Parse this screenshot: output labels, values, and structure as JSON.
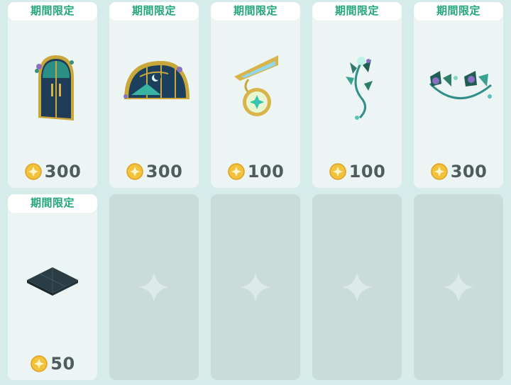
{
  "items": [
    {
      "badge": "期間限定",
      "price": "300",
      "icon": "arched-door-icon"
    },
    {
      "badge": "期間限定",
      "price": "300",
      "icon": "half-moon-window-icon"
    },
    {
      "badge": "期間限定",
      "price": "100",
      "icon": "hanging-sign-icon"
    },
    {
      "badge": "期間限定",
      "price": "100",
      "icon": "ivy-vine-icon"
    },
    {
      "badge": "期間限定",
      "price": "300",
      "icon": "flower-garland-icon"
    },
    {
      "badge": "期間限定",
      "price": "50",
      "icon": "dark-floor-tile-icon"
    }
  ],
  "empty_slot_icon": "sparkle-placeholder-icon",
  "colors": {
    "background": "#d6ecea",
    "card": "#ecf5f4",
    "empty_card": "#c9dcda",
    "badge_text": "#23a57c",
    "price_text": "#4e5c5d",
    "coin": "#f2c23a"
  }
}
